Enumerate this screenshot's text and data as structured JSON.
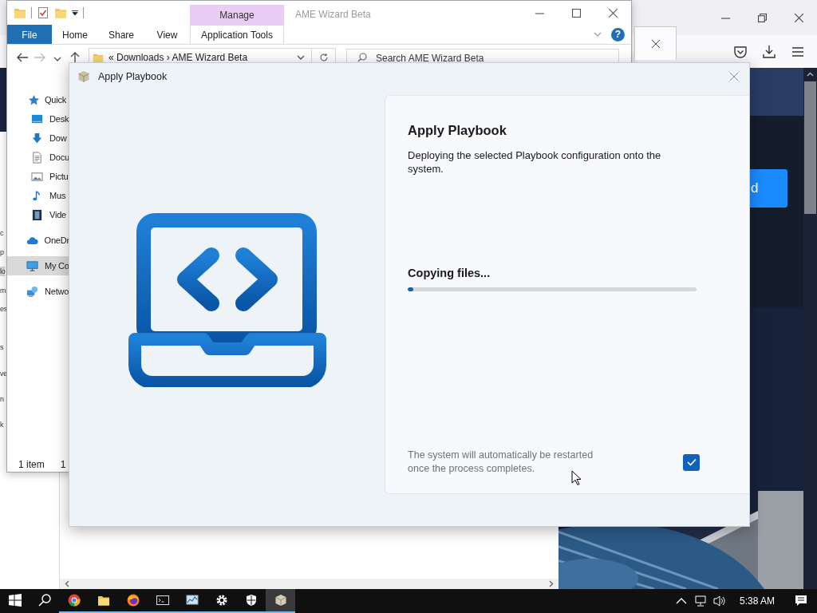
{
  "browser": {
    "page_button": "d",
    "page_fragments": [
      "c",
      "p",
      "lo",
      "m",
      "es",
      "s",
      "ve",
      "n",
      "k"
    ]
  },
  "explorer": {
    "title": "AME Wizard Beta",
    "context_tab": "Manage",
    "ribbon_tabs": [
      {
        "label": "File",
        "kind": "file",
        "selected": false
      },
      {
        "label": "Home",
        "kind": "tab",
        "selected": false
      },
      {
        "label": "Share",
        "kind": "tab",
        "selected": false
      },
      {
        "label": "View",
        "kind": "tab",
        "selected": false
      },
      {
        "label": "Application Tools",
        "kind": "tab",
        "selected": true
      }
    ],
    "help": "?",
    "address": "« Downloads › AME Wizard Beta",
    "search": {
      "placeholder": "Search AME Wizard Beta"
    },
    "nav": [
      {
        "label": "Quick",
        "selected": false,
        "children": [
          {
            "label": "Desk",
            "selected": false
          },
          {
            "label": "Dow",
            "selected": false
          },
          {
            "label": "Docu",
            "selected": false
          },
          {
            "label": "Pictu",
            "selected": false
          },
          {
            "label": "Mus",
            "selected": false
          },
          {
            "label": "Vide",
            "selected": false
          }
        ]
      },
      {
        "label": "OneDr",
        "selected": false
      },
      {
        "label": "My Co",
        "selected": true
      },
      {
        "label": "Netwo",
        "selected": false
      }
    ],
    "status": [
      "1 item",
      "1"
    ]
  },
  "dialog": {
    "title": "Apply Playbook",
    "heading": "Apply Playbook",
    "description": "Deploying the selected Playbook configuration onto the system.",
    "status": "Copying files...",
    "progress": {
      "level": 0.02
    },
    "note": "The system will automatically be restarted once the process completes.",
    "restart_checkbox": {
      "checked": true
    }
  },
  "taskbar": {
    "apps": [
      {
        "selected": false
      },
      {
        "selected": false
      },
      {
        "selected": false
      },
      {
        "selected": false
      },
      {
        "selected": false
      },
      {
        "selected": false
      },
      {
        "selected": false
      },
      {
        "selected": true
      }
    ],
    "clock": "5:38 AM"
  }
}
